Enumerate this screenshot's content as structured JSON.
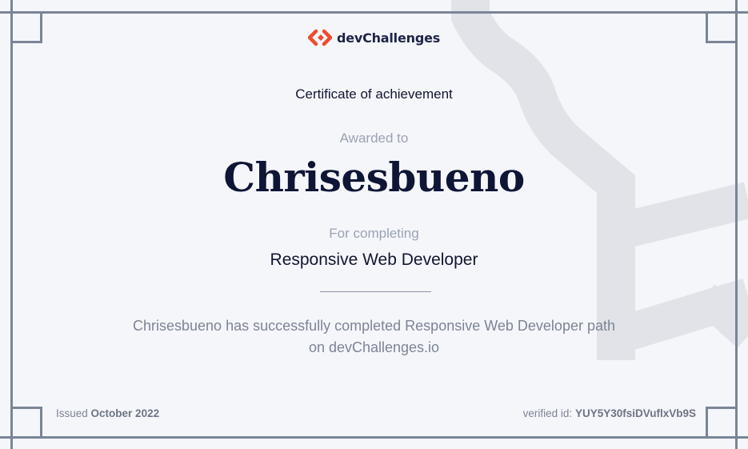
{
  "brand": {
    "name": "devChallenges",
    "accent_color": "#ef4c2e",
    "text_color": "#1e2448"
  },
  "certificate": {
    "title": "Certificate of achievement",
    "awarded_label": "Awarded to",
    "recipient": "Chrisesbueno",
    "for_label": "For completing",
    "course": "Responsive Web Developer",
    "description_line1": "Chrisesbueno has successfully completed Responsive Web Developer path",
    "description_line2": "on devChallenges.io"
  },
  "footer": {
    "issued_label": "Issued",
    "issued_date": "October 2022",
    "verified_label": "verified id:",
    "verified_id": "YUY5Y30fsiDVuflxVb9S"
  },
  "icons": [
    "devchallenges-logo-icon",
    "watermark-logo-icon"
  ],
  "colors": {
    "background": "#f5f6fa",
    "frame": "#7a8597",
    "watermark": "#e1e3e8"
  }
}
